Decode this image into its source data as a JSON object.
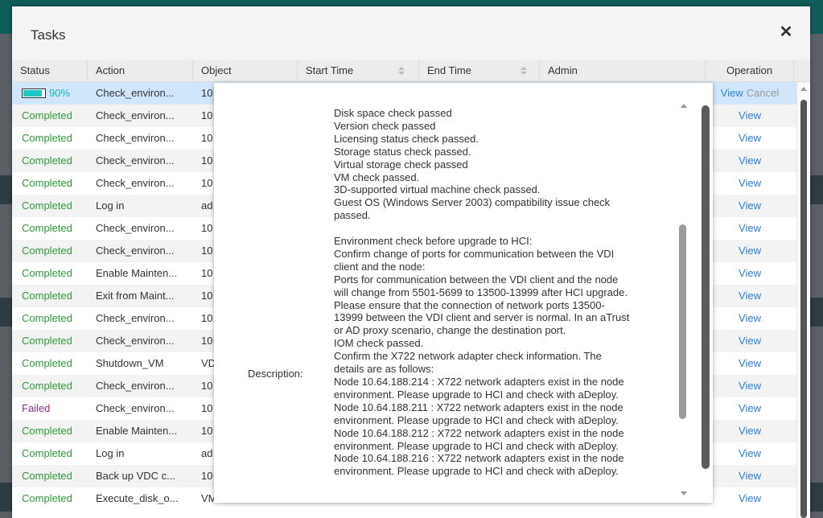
{
  "dialog": {
    "title": "Tasks"
  },
  "table": {
    "columns": {
      "status": "Status",
      "action": "Action",
      "object": "Object",
      "start_time": "Start Time",
      "end_time": "End Time",
      "admin": "Admin",
      "operation": "Operation"
    },
    "rows": [
      {
        "status": "90%",
        "status_type": "running",
        "progress": 0.9,
        "action": "Check_environ...",
        "object": "10",
        "op_view": "View",
        "op_cancel": "Cancel"
      },
      {
        "status": "Completed",
        "status_type": "completed",
        "action": "Check_environ...",
        "object": "10",
        "op_view": "View"
      },
      {
        "status": "Completed",
        "status_type": "completed",
        "action": "Check_environ...",
        "object": "10",
        "op_view": "View"
      },
      {
        "status": "Completed",
        "status_type": "completed",
        "action": "Check_environ...",
        "object": "10",
        "op_view": "View"
      },
      {
        "status": "Completed",
        "status_type": "completed",
        "action": "Check_environ...",
        "object": "10",
        "op_view": "View"
      },
      {
        "status": "Completed",
        "status_type": "completed",
        "action": "Log in",
        "object": "ad",
        "op_view": "View"
      },
      {
        "status": "Completed",
        "status_type": "completed",
        "action": "Check_environ...",
        "object": "10",
        "op_view": "View"
      },
      {
        "status": "Completed",
        "status_type": "completed",
        "action": "Check_environ...",
        "object": "10",
        "op_view": "View"
      },
      {
        "status": "Completed",
        "status_type": "completed",
        "action": "Enable Mainten...",
        "object": "10",
        "op_view": "View"
      },
      {
        "status": "Completed",
        "status_type": "completed",
        "action": "Exit from Maint...",
        "object": "10",
        "op_view": "View"
      },
      {
        "status": "Completed",
        "status_type": "completed",
        "action": "Check_environ...",
        "object": "10",
        "op_view": "View"
      },
      {
        "status": "Completed",
        "status_type": "completed",
        "action": "Check_environ...",
        "object": "10",
        "op_view": "View"
      },
      {
        "status": "Completed",
        "status_type": "completed",
        "action": "Shutdown_VM",
        "object": "VD",
        "op_view": "View"
      },
      {
        "status": "Completed",
        "status_type": "completed",
        "action": "Check_environ...",
        "object": "10",
        "op_view": "View"
      },
      {
        "status": "Failed",
        "status_type": "failed",
        "action": "Check_environ...",
        "object": "10",
        "op_view": "View"
      },
      {
        "status": "Completed",
        "status_type": "completed",
        "action": "Enable Mainten...",
        "object": "10",
        "op_view": "View"
      },
      {
        "status": "Completed",
        "status_type": "completed",
        "action": "Log in",
        "object": "ad",
        "op_view": "View"
      },
      {
        "status": "Completed",
        "status_type": "completed",
        "action": "Back up VDC c...",
        "object": "10",
        "op_view": "View"
      },
      {
        "status": "Completed",
        "status_type": "completed",
        "action": "Execute_disk_o...",
        "object": "VM",
        "op_view": "View"
      }
    ]
  },
  "popover": {
    "label": "Description:",
    "lines": [
      "Disk space check passed",
      "Version check passed",
      "Licensing status check passed.",
      "Storage status check passed.",
      "Virtual storage check passed",
      "VM check passed.",
      "3D-supported virtual machine check passed.",
      "Guest OS (Windows Server 2003) compatibility issue check",
      "passed.",
      "",
      "Environment check before upgrade to HCI:",
      "Confirm change of ports for communication between the VDI",
      "client and the node:",
      "Ports for communication between the VDI client and the node",
      "will change from 5501-5699 to 13500-13999 after HCI upgrade.",
      "Please ensure that the connection of network ports 13500-",
      "13999 between the VDI client and server is normal. In an aTrust",
      "or AD proxy scenario, change the destination port.",
      "IOM check passed.",
      "Confirm the X722 network adapter check information. The",
      "details are as follows:",
      "Node 10.64.188.214 : X722 network adapters exist in the node",
      "environment. Please upgrade to HCI and check with aDeploy.",
      "Node 10.64.188.211 : X722 network adapters exist in the node",
      "environment. Please upgrade to HCI and check with aDeploy.",
      "Node 10.64.188.212 : X722 network adapters exist in the node",
      "environment. Please upgrade to HCI and check with aDeploy.",
      "Node 10.64.188.216 : X722 network adapters exist in the node",
      "environment. Please upgrade to HCI and check with aDeploy."
    ]
  },
  "colors": {
    "completed": "#2e9c3a",
    "failed": "#8e2b8f",
    "running": "#16b5b5",
    "link": "#2a7fd4",
    "selected_row": "#cfe6fb"
  },
  "icons": {
    "close": "close-icon",
    "sort": "sort-icon"
  }
}
